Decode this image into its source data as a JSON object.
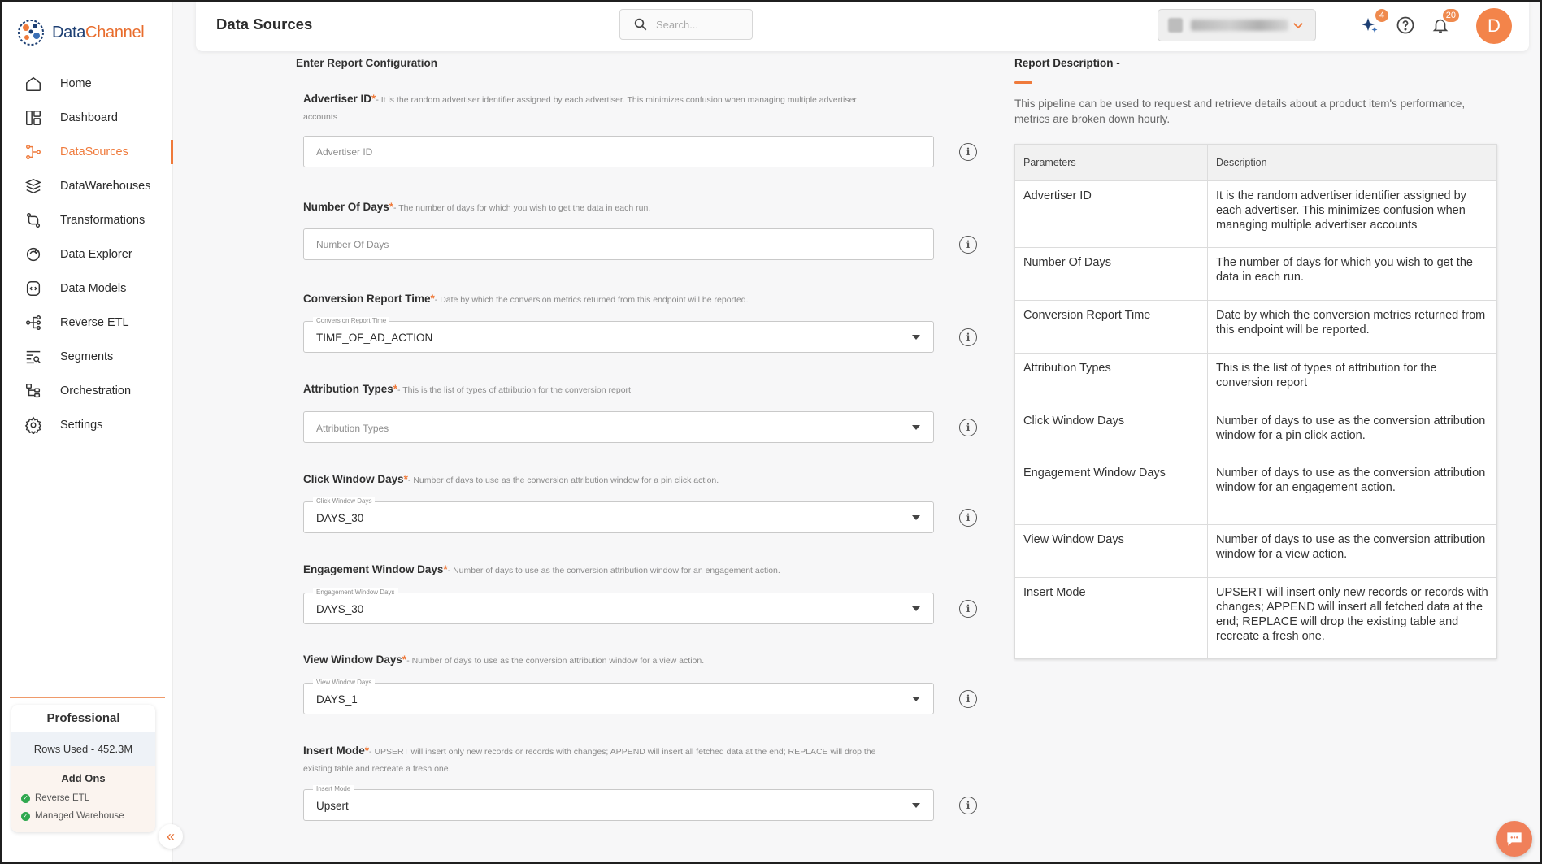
{
  "app": {
    "name_part1": "Data",
    "name_part2": "Channel"
  },
  "sidebar": {
    "items": [
      {
        "label": "Home",
        "icon": "home-icon"
      },
      {
        "label": "Dashboard",
        "icon": "dashboard-icon"
      },
      {
        "label": "DataSources",
        "icon": "datasources-icon",
        "active": true
      },
      {
        "label": "DataWarehouses",
        "icon": "datawarehouses-icon"
      },
      {
        "label": "Transformations",
        "icon": "transformations-icon"
      },
      {
        "label": "Data Explorer",
        "icon": "data-explorer-icon"
      },
      {
        "label": "Data Models",
        "icon": "data-models-icon"
      },
      {
        "label": "Reverse ETL",
        "icon": "reverse-etl-icon"
      },
      {
        "label": "Segments",
        "icon": "segments-icon"
      },
      {
        "label": "Orchestration",
        "icon": "orchestration-icon"
      },
      {
        "label": "Settings",
        "icon": "settings-icon"
      }
    ],
    "plan": {
      "name": "Professional",
      "rows_used": "Rows Used - 452.3M",
      "addons_title": "Add Ons",
      "addons": [
        "Reverse ETL",
        "Managed Warehouse"
      ]
    }
  },
  "header": {
    "title": "Data Sources",
    "search_placeholder": "Search...",
    "ai_badge": "4",
    "notifications_badge": "20",
    "avatar_letter": "D"
  },
  "form": {
    "section_title": "Enter Report Configuration",
    "fields": [
      {
        "label": "Advertiser ID",
        "required": "*",
        "hint": "- It is the random advertiser identifier assigned by each advertiser. This minimizes confusion when managing multiple advertiser accounts",
        "type": "text",
        "placeholder": "Advertiser ID",
        "value": ""
      },
      {
        "label": "Number Of Days",
        "required": "*",
        "hint": "- The number of days for which you wish to get the data in each run.",
        "type": "text",
        "placeholder": "Number Of Days",
        "value": ""
      },
      {
        "label": "Conversion Report Time",
        "required": "*",
        "hint": "- Date by which the conversion metrics returned from this endpoint will be reported.",
        "type": "select",
        "float_label": "Conversion Report Time",
        "value": "TIME_OF_AD_ACTION"
      },
      {
        "label": "Attribution Types",
        "required": "*",
        "hint": "- This is the list of types of attribution for the conversion report",
        "type": "select",
        "placeholder": "Attribution Types",
        "value": ""
      },
      {
        "label": "Click Window Days",
        "required": "*",
        "hint": "- Number of days to use as the conversion attribution window for a pin click action.",
        "type": "select",
        "float_label": "Click Window Days",
        "value": "DAYS_30"
      },
      {
        "label": "Engagement Window Days",
        "required": "*",
        "hint": "- Number of days to use as the conversion attribution window for an engagement action.",
        "type": "select",
        "float_label": "Engagement Window Days",
        "value": "DAYS_30"
      },
      {
        "label": "View Window Days",
        "required": "*",
        "hint": "- Number of days to use as the conversion attribution window for a view action.",
        "type": "select",
        "float_label": "View Window Days",
        "value": "DAYS_1"
      },
      {
        "label": "Insert Mode",
        "required": "*",
        "hint": "- UPSERT will insert only new records or records with changes; APPEND will insert all fetched data at the end; REPLACE will drop the existing table and recreate a fresh one.",
        "type": "select",
        "float_label": "Insert Mode",
        "value": "Upsert"
      }
    ]
  },
  "report": {
    "title": "Report Description -",
    "description": "This pipeline can be used to request and retrieve details about a product item's performance, metrics are broken down hourly.",
    "headers": [
      "Parameters",
      "Description"
    ],
    "rows": [
      [
        "Advertiser ID",
        "It is the random advertiser identifier assigned by each advertiser. This minimizes confusion when managing multiple advertiser accounts"
      ],
      [
        "Number Of Days",
        "The number of days for which you wish to get the data in each run."
      ],
      [
        "Conversion Report Time",
        "Date by which the conversion metrics returned from this endpoint will be reported."
      ],
      [
        "Attribution Types",
        "This is the list of types of attribution for the conversion report"
      ],
      [
        "Click Window Days",
        "Number of days to use as the conversion attribution window for a pin click action."
      ],
      [
        "Engagement Window Days",
        "Number of days to use as the conversion attribution window for an engagement action."
      ],
      [
        "View Window Days",
        "Number of days to use as the conversion attribution window for a view action."
      ],
      [
        "Insert Mode",
        "UPSERT will insert only new records or records with changes; APPEND will insert all fetched data at the end; REPLACE will drop the existing table and recreate a fresh one."
      ]
    ]
  },
  "colors": {
    "accent": "#ef7a3b",
    "brand_blue": "#1d3f73"
  }
}
